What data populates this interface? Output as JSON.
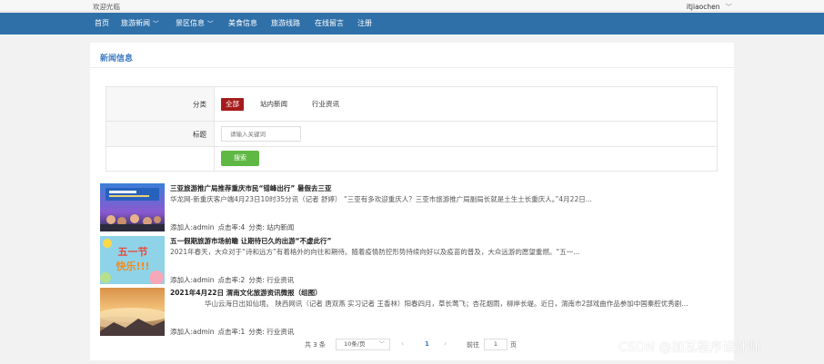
{
  "topbar": {
    "welcome": "欢迎光临",
    "username": "itjiaochen",
    "user_caret": "﹀"
  },
  "nav": {
    "items": [
      {
        "label": "首页"
      },
      {
        "label": "旅游新闻",
        "caret": "﹀"
      },
      {
        "label": "景区信息",
        "caret": "﹀"
      },
      {
        "label": "美食信息"
      },
      {
        "label": "旅游线路"
      },
      {
        "label": "在线留言"
      },
      {
        "label": "注册"
      }
    ]
  },
  "section": {
    "title": "新闻信息"
  },
  "filter": {
    "category_label": "分类",
    "categories": [
      "全部",
      "站内新闻",
      "行业资讯"
    ],
    "active_category": "全部",
    "title_label": "标题",
    "title_placeholder": "请输入关键词",
    "search_label": "搜索"
  },
  "news": [
    {
      "title": "三亚旅游推广局推荐重庆市民“错峰出行” 暑假去三亚",
      "desc": "华龙网-新重庆客户端4月23日10时35分讯（记者 舒婷） “三亚有多欢迎重庆人？三亚市旅游推广局副局长就是土生土长重庆人。”4月22日...",
      "meta": {
        "added_by": "添加人:admin",
        "clicks": "点击率:4",
        "category": "分类: 站内新闻"
      }
    },
    {
      "title": "五一假期旅游市场前瞻 让期待已久的出游“不虚此行”",
      "desc": "2021年春天，大众对于“诗和远方”有着格外的向往和期待。随着疫情防控形势持续向好以及疫苗的普及，大众远游的愿望重燃。“五一...",
      "meta": {
        "added_by": "添加人:admin",
        "clicks": "点击率:2",
        "category": "分类: 行业资讯"
      }
    },
    {
      "title": "2021年4月22日 渭南文化旅游资讯微报（组图）",
      "desc": "华山云海日出如仙境。 陕西网讯（记者 唐双燕 实习记者 王香林）阳春四月，草长莺飞；杏花烟雨，柳岸长堤。近日，渭南市2部戏曲作品参加中国秦腔优秀剧...",
      "meta": {
        "added_by": "添加人:admin",
        "clicks": "点击率:1",
        "category": "分类: 行业资讯"
      }
    }
  ],
  "thumb2_text": {
    "line1": "五一节",
    "line2": "快乐!!!"
  },
  "pagination": {
    "total": "共 3 条",
    "page_size": "10条/页",
    "page_size_caret": "﹀",
    "prev": "‹",
    "current_page": "1",
    "next": "›",
    "goto_label": "前往",
    "goto_value": "1",
    "page_unit": "页"
  },
  "watermark": "CSDN @加瓦程序设计师",
  "colors": {
    "nav_bg": "#2f70a9",
    "active_chip": "#a51b1b",
    "search_btn": "#5fb843",
    "title_blue": "#3f7cc1"
  }
}
